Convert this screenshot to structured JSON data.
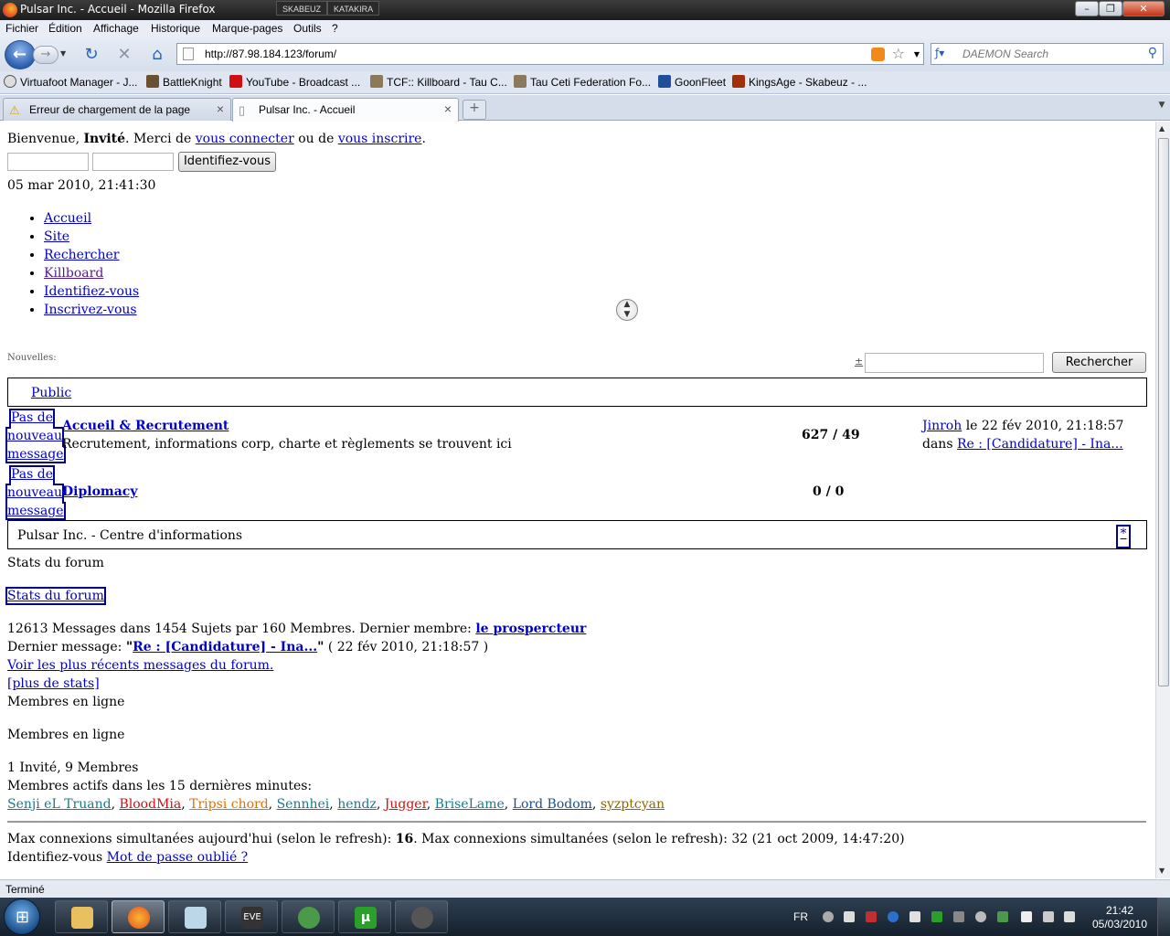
{
  "window": {
    "title": "Pulsar Inc. - Accueil - Mozilla Firefox",
    "chips": [
      "SKABEUZ",
      "KATAKIRA"
    ]
  },
  "menu": [
    "Fichier",
    "Édition",
    "Affichage",
    "Historique",
    "Marque-pages",
    "Outils",
    "?"
  ],
  "nav": {
    "url": "http://87.98.184.123/forum/",
    "search_placeholder": "DAEMON Search"
  },
  "bookmarks": [
    "Virtuafoot Manager - J...",
    "BattleKnight",
    "YouTube - Broadcast ...",
    "TCF:: Killboard - Tau C...",
    "Tau Ceti Federation Fo...",
    "GoonFleet",
    "KingsAge - Skabeuz - ..."
  ],
  "tabs": [
    {
      "label": "Erreur de chargement de la page",
      "active": false
    },
    {
      "label": "Pulsar Inc. - Accueil",
      "active": true
    }
  ],
  "page": {
    "welcome": {
      "prefix": "Bienvenue, ",
      "user": "Invité",
      "middle": ". Merci de ",
      "login_link": "vous connecter",
      "or": " ou de ",
      "register_link": "vous inscrire",
      "end": "."
    },
    "login_button": "Identifiez-vous",
    "datetime": "05 mar 2010, 21:41:30",
    "nav_links": [
      "Accueil",
      "Site",
      "Rechercher",
      "Killboard",
      "Identifiez-vous",
      "Inscrivez-vous"
    ],
    "news_label": "Nouvelles:",
    "search_button": "Rechercher",
    "search_marker": "±",
    "category": "Public",
    "forums": [
      {
        "status": [
          "Pas de",
          "nouveau",
          "message"
        ],
        "title": "Accueil & Recrutement",
        "description": "Recrutement, informations corp, charte et règlements se trouvent ici",
        "posts": "627",
        "topics": "49",
        "last_user": "Jinroh",
        "last_date": " le 22 fév 2010, 21:18:57",
        "last_in": "dans ",
        "last_topic": "Re : [Candidature] - Ina..."
      },
      {
        "status": [
          "Pas de",
          "nouveau",
          "message"
        ],
        "title": "Diplomacy",
        "description": "",
        "posts": "0",
        "topics": "0"
      }
    ],
    "info_center": "Pulsar Inc. - Centre d'informations",
    "info_center_toggle": "*",
    "stats_heading": "Stats du forum",
    "stats_link": "Stats du forum",
    "stats_line": {
      "text": "12613 Messages dans 1454 Sujets par 160 Membres. Dernier membre: ",
      "member": "le prospercteur"
    },
    "last_message": {
      "prefix": "Dernier message: ",
      "quote_open": "\"",
      "topic": "Re : [Candidature] - Ina...",
      "quote_close": "\"",
      "date": " ( 22 fév 2010, 21:18:57 )"
    },
    "recent_link": "Voir les plus récents messages du forum.",
    "more_stats": "[plus de stats]",
    "online_heading": "Membres en ligne",
    "online_heading2": "Membres en ligne",
    "online_count": "1 Invité, 9 Membres",
    "active_label": "Membres actifs dans les 15 dernières minutes:",
    "members": [
      {
        "name": "Senji eL Truand",
        "color": "#1a7a8a"
      },
      {
        "name": "BloodMia",
        "color": "#d01010"
      },
      {
        "name": "Tripsi chord",
        "color": "#e07000"
      },
      {
        "name": "Sennhei",
        "color": "#1a7a8a"
      },
      {
        "name": "hendz",
        "color": "#1a7a8a"
      },
      {
        "name": "Jugger",
        "color": "#d01010"
      },
      {
        "name": "BriseLame",
        "color": "#1a7a8a"
      },
      {
        "name": "Lord Bodom",
        "color": "#1a4f8a"
      },
      {
        "name": "syzptcyan",
        "color": "#8a6a00"
      }
    ],
    "max_line": {
      "a": "Max connexions simultanées aujourd'hui (selon le refresh): ",
      "b": "16",
      "c": ". Max connexions simultanées (selon le refresh): 32 (21 oct 2009, 14:47:20)"
    },
    "footer": {
      "prefix": "Identifiez-vous ",
      "link": "Mot de passe oublié ?"
    }
  },
  "status": "Terminé",
  "tray": {
    "lang": "FR",
    "time": "21:42",
    "date": "05/03/2010"
  }
}
